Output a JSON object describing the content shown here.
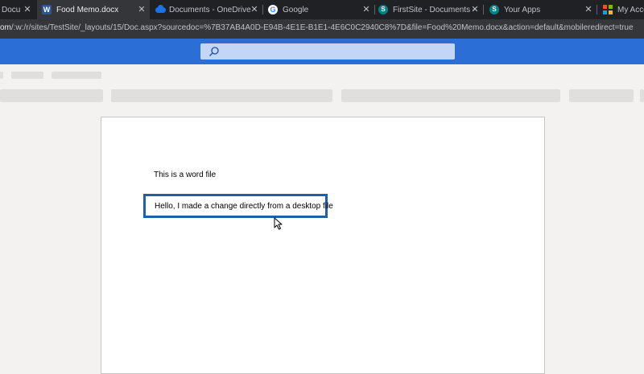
{
  "browser": {
    "tabs": [
      {
        "title": "Docu",
        "icon": "document-icon",
        "active": false
      },
      {
        "title": "Food Memo.docx",
        "icon": "word-icon",
        "active": true
      },
      {
        "title": "Documents - OneDrive",
        "icon": "onedrive-icon",
        "active": false
      },
      {
        "title": "Google",
        "icon": "google-icon",
        "active": false
      },
      {
        "title": "FirstSite - Documents - All",
        "icon": "sharepoint-icon",
        "active": false
      },
      {
        "title": "Your Apps",
        "icon": "sharepoint-icon",
        "active": false
      },
      {
        "title": "My Accou",
        "icon": "microsoft-icon",
        "active": false
      }
    ],
    "close_glyph": "✕",
    "url_host": "om",
    "url_path": "/:w:/r/sites/TestSite/_layouts/15/Doc.aspx?sourcedoc=%7B37AB4A0D-E94B-4E1E-B1E1-4E6C0C2940C8%7D&file=Food%20Memo.docx&action=default&mobileredirect=true"
  },
  "office": {
    "header_color": "#2b6fd6",
    "search_placeholder": ""
  },
  "document": {
    "paragraphs": [
      "This is a word file",
      "Hello, I made a change directly from a desktop file"
    ],
    "highlight_color": "#1f5fa8"
  }
}
